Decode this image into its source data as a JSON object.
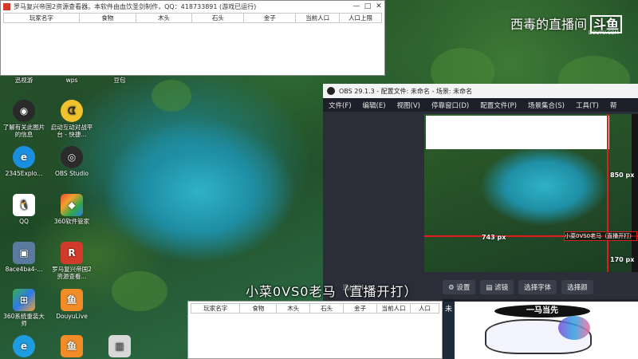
{
  "game_window": {
    "title": "罗马复兴帝国2资源查看器。本软件由血饮圣剑制作，QQ：418733891 (游戏已运行)",
    "columns": [
      "玩家名字",
      "食物",
      "木头",
      "石头",
      "金子",
      "当前人口",
      "人口上限"
    ],
    "controls": {
      "minimize": "—",
      "maximize": "□",
      "close": "✕"
    }
  },
  "watermark": {
    "text": "西毒的直播间",
    "logo": "斗鱼",
    "sub": "DOUYU.COM"
  },
  "desktop_icons": [
    {
      "label": "迅视游",
      "icon": "app-icon",
      "color": "#3a5fb0"
    },
    {
      "label": "wps",
      "icon": "wps-icon",
      "color": "#cc3b2b"
    },
    {
      "label": "豆包",
      "icon": "doubao-icon",
      "color": "#4a90e2"
    },
    {
      "label": "了解有关此图片的信息",
      "icon": "camera-icon",
      "color": "#222"
    },
    {
      "label": "启动互动对战平台 - 快捷...",
      "icon": "pacman-icon",
      "color": "#f2c12e"
    },
    {
      "label": "2345Explo...",
      "icon": "browser-icon",
      "color": "#1a8fe0"
    },
    {
      "label": "OBS Studio",
      "icon": "obs-icon",
      "color": "#2b2b2b"
    },
    {
      "label": "QQ",
      "icon": "qq-icon",
      "color": "#ffffff"
    },
    {
      "label": "360软件管家",
      "icon": "360-icon",
      "color": "#e84a2e"
    },
    {
      "label": "8ace4ba4-...",
      "icon": "image-icon",
      "color": "#5a7aa0"
    },
    {
      "label": "罗马复兴帝国2资源查看...",
      "icon": "rome-icon",
      "color": "#d23b2a"
    },
    {
      "label": "360系统重装大师",
      "icon": "360-reinstall-icon",
      "color": "#3bb04a"
    },
    {
      "label": "DouyuLive",
      "icon": "douyu-icon",
      "color": "#f28c28"
    },
    {
      "label": "",
      "icon": "edge-icon",
      "color": "#1f9be0"
    },
    {
      "label": "",
      "icon": "douyu2-icon",
      "color": "#f28c28"
    },
    {
      "label": "",
      "icon": "folder-icon",
      "color": "#d8d8d8"
    }
  ],
  "obs": {
    "title": "OBS 29.1.3 - 配置文件: 未命名 - 场景: 未命名",
    "menu": [
      "文件(F)",
      "编辑(E)",
      "视图(V)",
      "停靠窗口(D)",
      "配置文件(P)",
      "场景集合(S)",
      "工具(T)",
      "帮"
    ],
    "measure": {
      "v": "850 px",
      "h": "743 px",
      "b": "170 px"
    },
    "selected_source": "小菜0VS0老马（直播开打）",
    "buttons": [
      "设置",
      "滤镜",
      "选择字体",
      "选择颜"
    ],
    "label_partial": "选(GDI+)"
  },
  "bottom_window": {
    "columns": [
      "玩家名字",
      "食物",
      "木头",
      "石头",
      "金子",
      "当前人口",
      "人口"
    ],
    "side_label": "未"
  },
  "caption": "小菜0VS0老马（直播开打）",
  "unicorn": {
    "banner": "一马当先"
  }
}
